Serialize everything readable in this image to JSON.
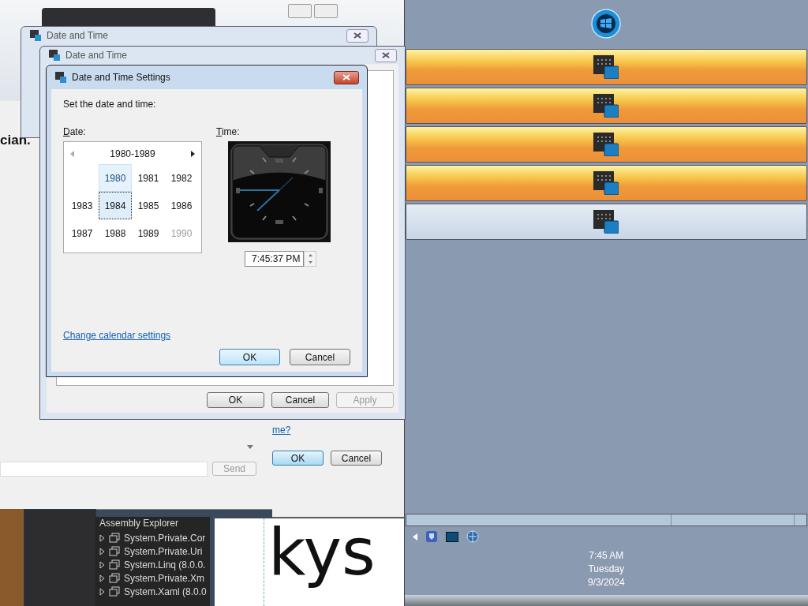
{
  "chat_window": {
    "text_fragment": "cian.",
    "send_button": {
      "label": "Send",
      "disabled": true
    }
  },
  "back_dialog": {
    "title": "Date and Time"
  },
  "middle_dialog": {
    "title": "Date and Time",
    "buttons": [
      {
        "label": "OK",
        "disabled": false
      },
      {
        "label": "Cancel",
        "disabled": false
      },
      {
        "label": "Apply",
        "disabled": true
      }
    ]
  },
  "lower_dialog": {
    "link": "me?",
    "buttons": [
      {
        "label": "OK",
        "default": true
      },
      {
        "label": "Cancel",
        "default": false
      }
    ]
  },
  "settings_dialog": {
    "title": "Date and Time Settings",
    "instruction": "Set the date and time:",
    "date_label": "Date:",
    "time_label": "Time:",
    "calendar": {
      "header": "1980-1989",
      "years": [
        {
          "label": "1980",
          "selected": false,
          "hovered": true,
          "dimmed": false
        },
        {
          "label": "1981",
          "selected": false,
          "hovered": false,
          "dimmed": false
        },
        {
          "label": "1982",
          "selected": false,
          "hovered": false,
          "dimmed": false
        },
        {
          "label": "1983",
          "selected": false,
          "hovered": false,
          "dimmed": false
        },
        {
          "label": "1984",
          "selected": true,
          "hovered": false,
          "dimmed": false
        },
        {
          "label": "1985",
          "selected": false,
          "hovered": false,
          "dimmed": false
        },
        {
          "label": "1986",
          "selected": false,
          "hovered": false,
          "dimmed": false
        },
        {
          "label": "1987",
          "selected": false,
          "hovered": false,
          "dimmed": false
        },
        {
          "label": "1988",
          "selected": false,
          "hovered": false,
          "dimmed": false
        },
        {
          "label": "1989",
          "selected": false,
          "hovered": false,
          "dimmed": false
        },
        {
          "label": "1990",
          "selected": false,
          "hovered": false,
          "dimmed": true
        }
      ]
    },
    "time_value": "7:45:37 PM",
    "link": "Change calendar settings",
    "buttons": [
      {
        "label": "OK",
        "default": true
      },
      {
        "label": "Cancel",
        "default": false
      }
    ]
  },
  "assembly_explorer": {
    "title": "Assembly Explorer",
    "items": [
      {
        "label": "System.Private.Cor",
        "expanded": false
      },
      {
        "label": "System.Private.Uri",
        "expanded": false
      },
      {
        "label": "System.Linq (8.0.0.",
        "expanded": false
      },
      {
        "label": "System.Private.Xm",
        "expanded": false
      },
      {
        "label": "System.Xaml (8.0.0",
        "expanded": false
      }
    ]
  },
  "editor": {
    "text": "kys"
  },
  "taskbar": {
    "buttons": [
      {
        "active": true
      },
      {
        "active": true
      },
      {
        "active": true
      },
      {
        "active": true
      },
      {
        "active": false
      }
    ],
    "clock": {
      "time": "7:45 AM",
      "day": "Tuesday",
      "date": "9/3/2024"
    }
  }
}
